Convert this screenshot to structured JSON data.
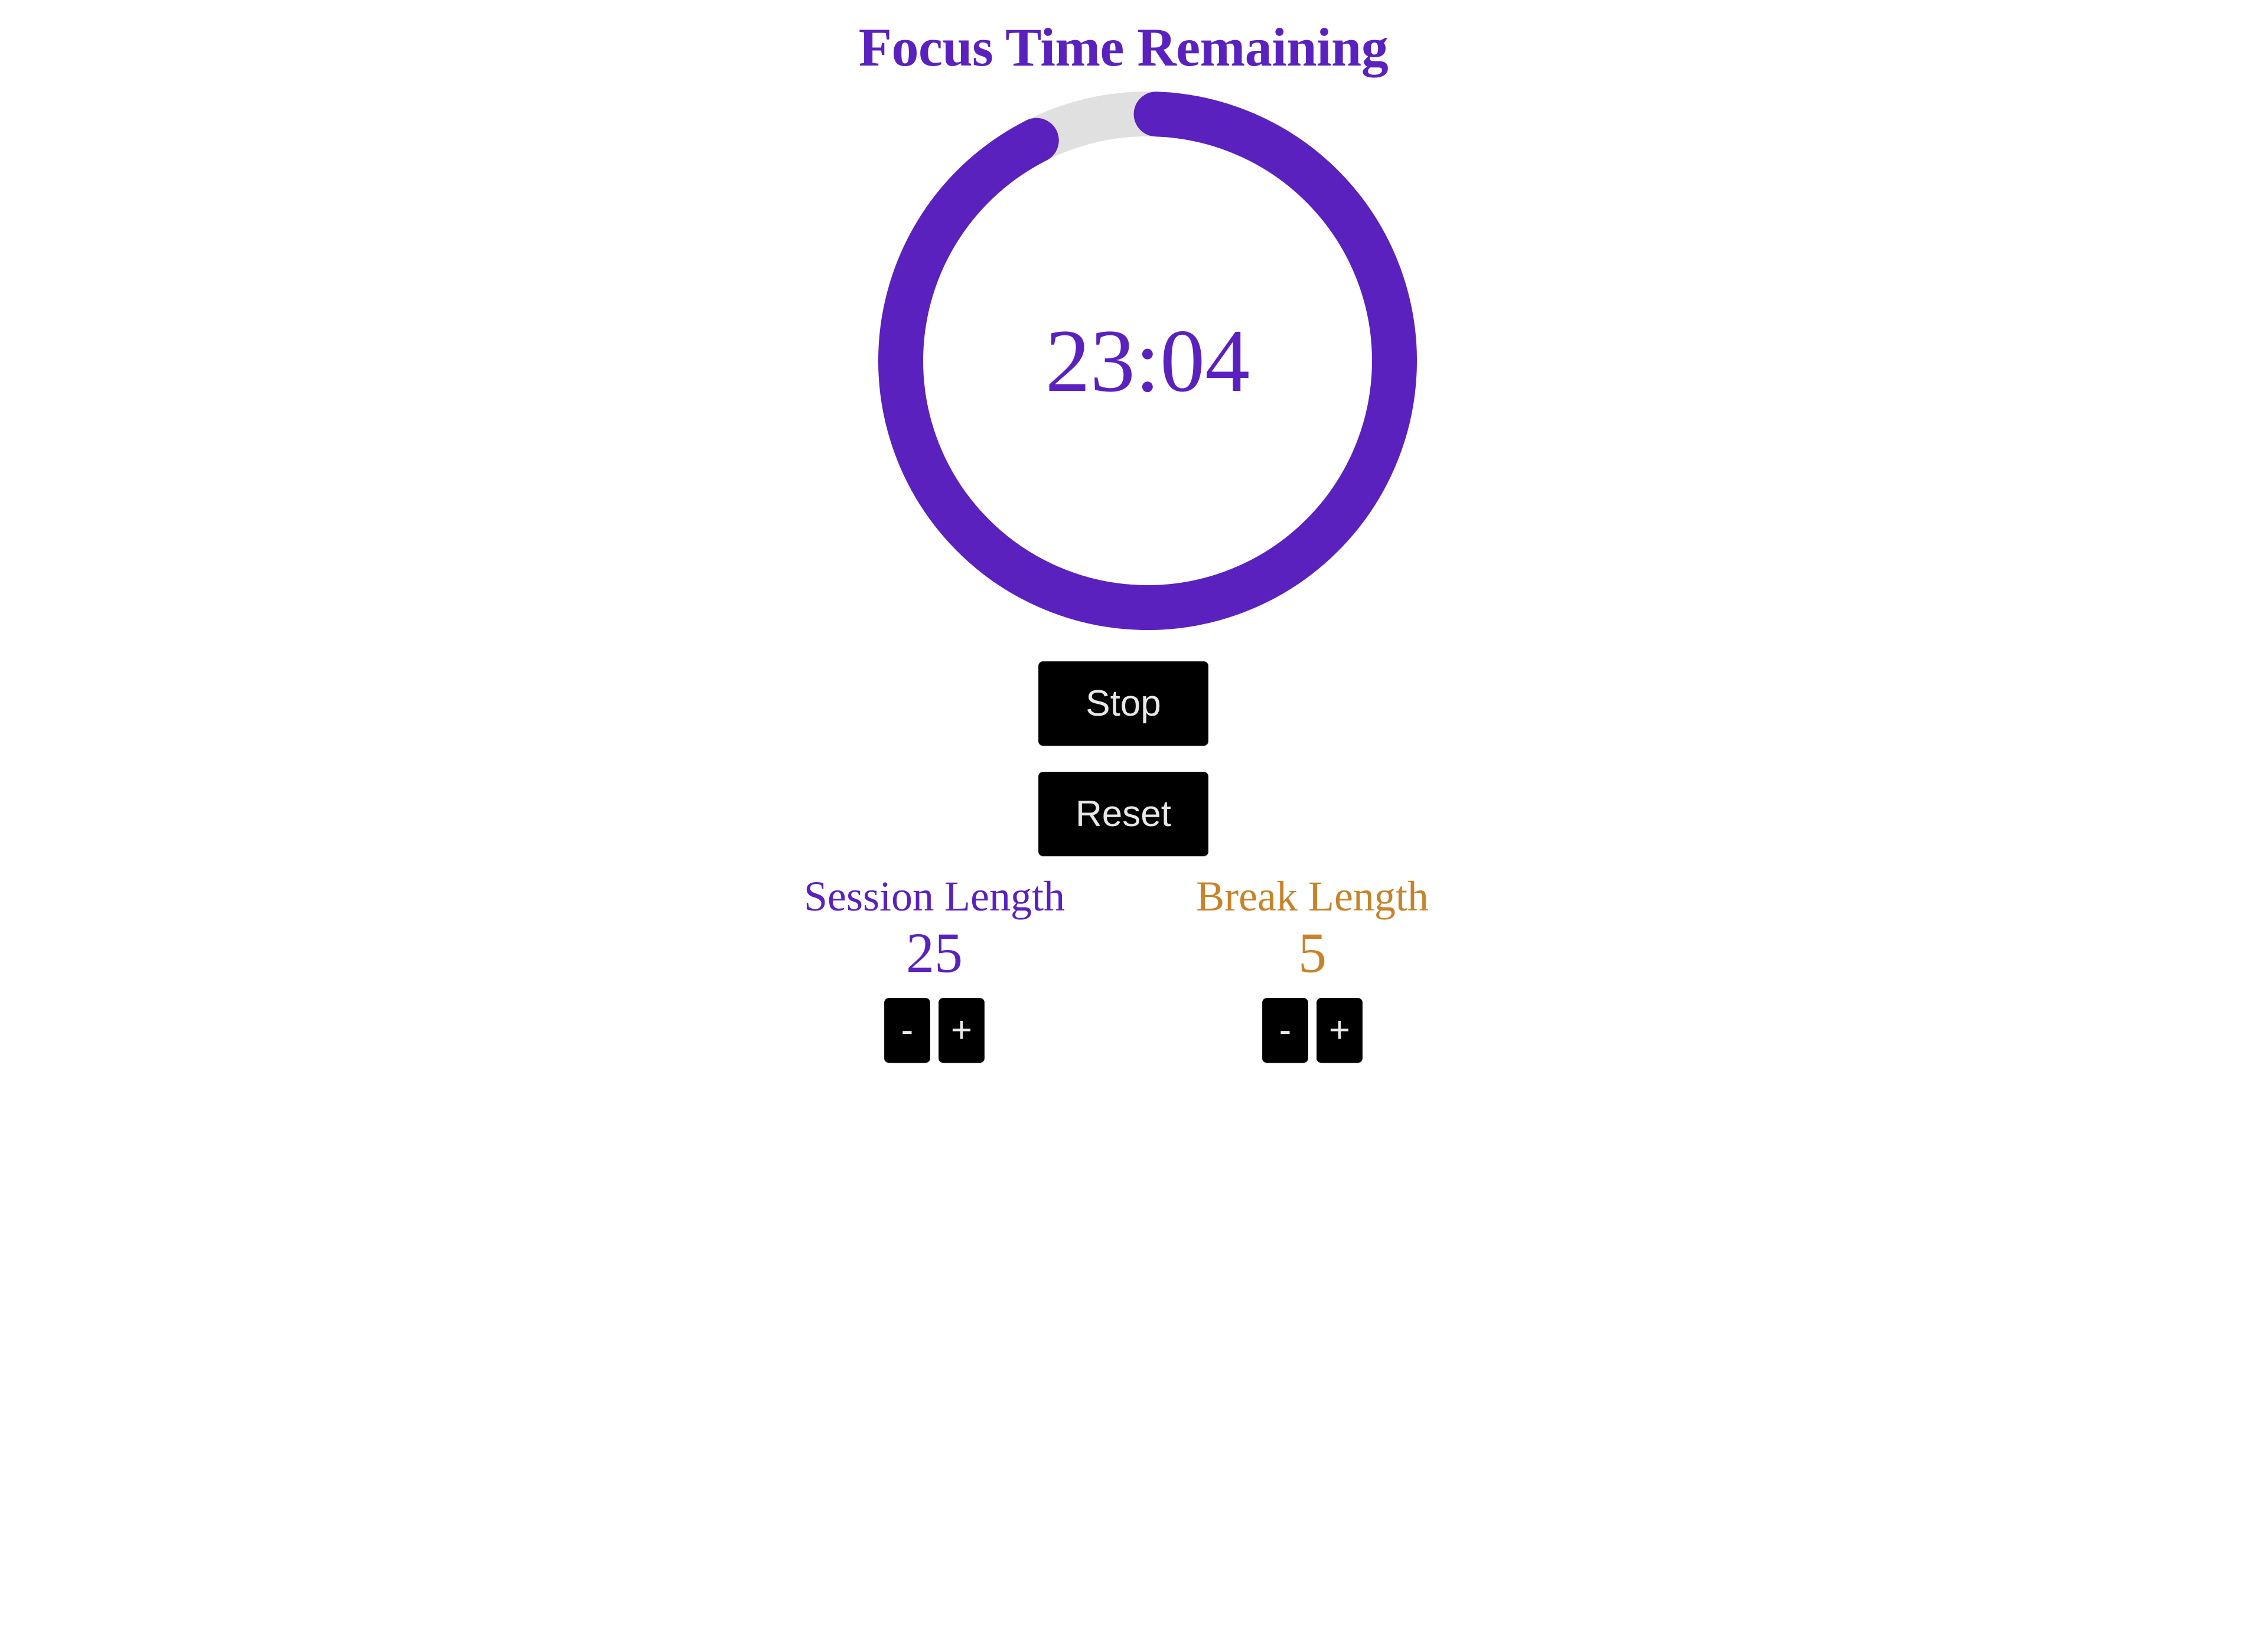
{
  "header": {
    "title": "Focus Time Remaining",
    "title_color": "#5B21BF"
  },
  "timer": {
    "display": "23:04",
    "label_name": "countdown-display",
    "progress_percent": 92,
    "arc_color": "#5B21BF",
    "track_color": "#E0E0E0",
    "text_color": "#5B21BF"
  },
  "controls": {
    "stop_label": "Stop",
    "reset_label": "Reset"
  },
  "session": {
    "label": "Session Length",
    "value": "25",
    "decrement_label": "-",
    "increment_label": "+",
    "color": "#5B21BF"
  },
  "break": {
    "label": "Break Length",
    "value": "5",
    "decrement_label": "-",
    "increment_label": "+",
    "color": "#C8832A"
  }
}
